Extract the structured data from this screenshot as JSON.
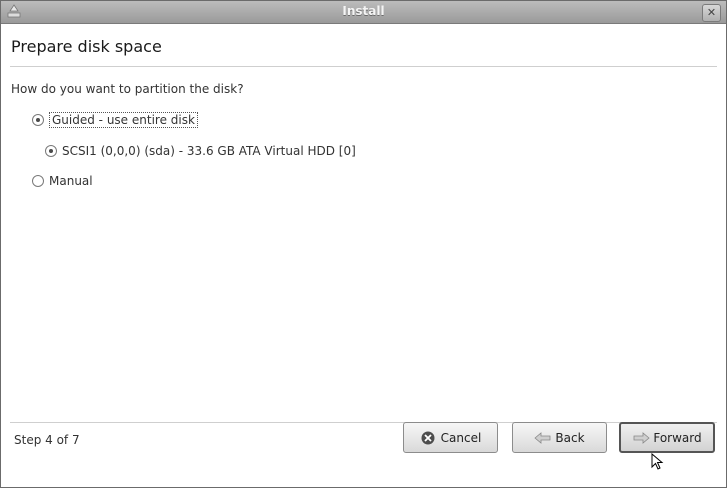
{
  "window": {
    "title": "Install",
    "close_symbol": "✕"
  },
  "page": {
    "title": "Prepare disk space",
    "question": "How do you want to partition the disk?"
  },
  "options": [
    {
      "label": "Guided - use entire disk",
      "selected": true
    },
    {
      "label": "SCSI1 (0,0,0) (sda) - 33.6 GB ATA Virtual HDD [0]",
      "selected": true
    },
    {
      "label": "Manual",
      "selected": false
    }
  ],
  "footer": {
    "step": "Step 4 of 7",
    "cancel_label": "Cancel",
    "back_label": "Back",
    "forward_label": "Forward"
  },
  "icons": {
    "app": "installer-icon",
    "cancel": "cancel-circle-icon",
    "back": "left-arrow-icon",
    "forward": "right-arrow-icon"
  }
}
